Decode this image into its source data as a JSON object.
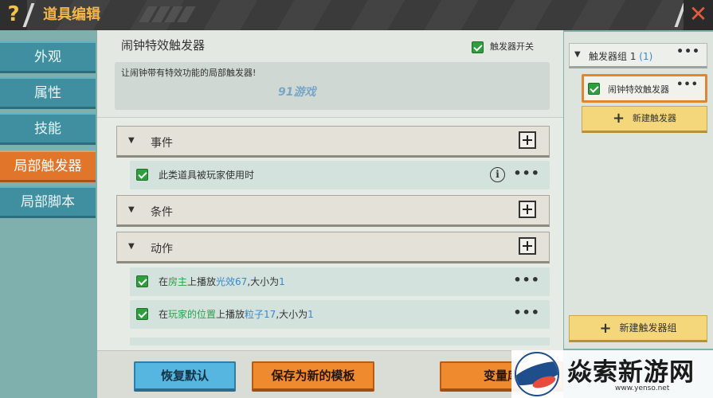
{
  "header": {
    "help_label": "?",
    "title": "道具编辑",
    "close_label": "✕"
  },
  "left_tabs": [
    {
      "label": "外观",
      "active": false
    },
    {
      "label": "属性",
      "active": false
    },
    {
      "label": "技能",
      "active": false
    },
    {
      "label": "局部触发器",
      "active": true
    },
    {
      "label": "局部脚本",
      "active": false
    }
  ],
  "trigger": {
    "name": "闹钟特效触发器",
    "switch_label": "触发器开关",
    "switch_checked": true,
    "description": "让闹钟带有特效功能的局部触发器!",
    "watermark": "91游戏"
  },
  "sections": {
    "event": {
      "label": "事件",
      "add_label": "+"
    },
    "condition": {
      "label": "条件",
      "add_label": "+"
    },
    "action": {
      "label": "动作",
      "add_label": "+"
    }
  },
  "event_items": [
    {
      "text": "此类道具被玩家使用时",
      "info_label": "i",
      "more_label": "•••"
    }
  ],
  "action_items": [
    {
      "prefix": "在",
      "target": "房主",
      "mid": "上播放",
      "effect": "光效67",
      "sep": ",大小为",
      "size": "1",
      "more_label": "•••"
    },
    {
      "prefix": "在",
      "target": "玩家的位置",
      "mid": "上播放",
      "effect": "粒子17",
      "sep": ",大小为",
      "size": "1",
      "more_label": "•••"
    }
  ],
  "bottom_buttons": {
    "reset": "恢复默认",
    "save_template": "保存为新的模板",
    "variables": "变量库"
  },
  "right_panel": {
    "group_label": "触发器组 1",
    "group_count": "(1)",
    "group_more": "•••",
    "trigger_item": "闹钟特效触发器",
    "trigger_more": "•••",
    "new_trigger": "新建触发器",
    "new_group": "新建触发器组",
    "plus": "+"
  },
  "logo": {
    "brand": "焱索新游网",
    "url": "www.yenso.net"
  },
  "colors": {
    "accent_orange": "#e1762a",
    "tab_blue": "#3f8fa0",
    "check_green": "#2f9e3e",
    "highlight_green": "#2aa24a",
    "highlight_blue": "#3a88c8",
    "title_orange": "#f4b54c"
  },
  "icons": {
    "help": "question-icon",
    "close": "close-icon",
    "expand": "triangle-down-icon",
    "add": "plus-box-icon",
    "info": "info-circle-icon",
    "more": "ellipsis-icon",
    "check": "checkbox-checked-icon"
  }
}
